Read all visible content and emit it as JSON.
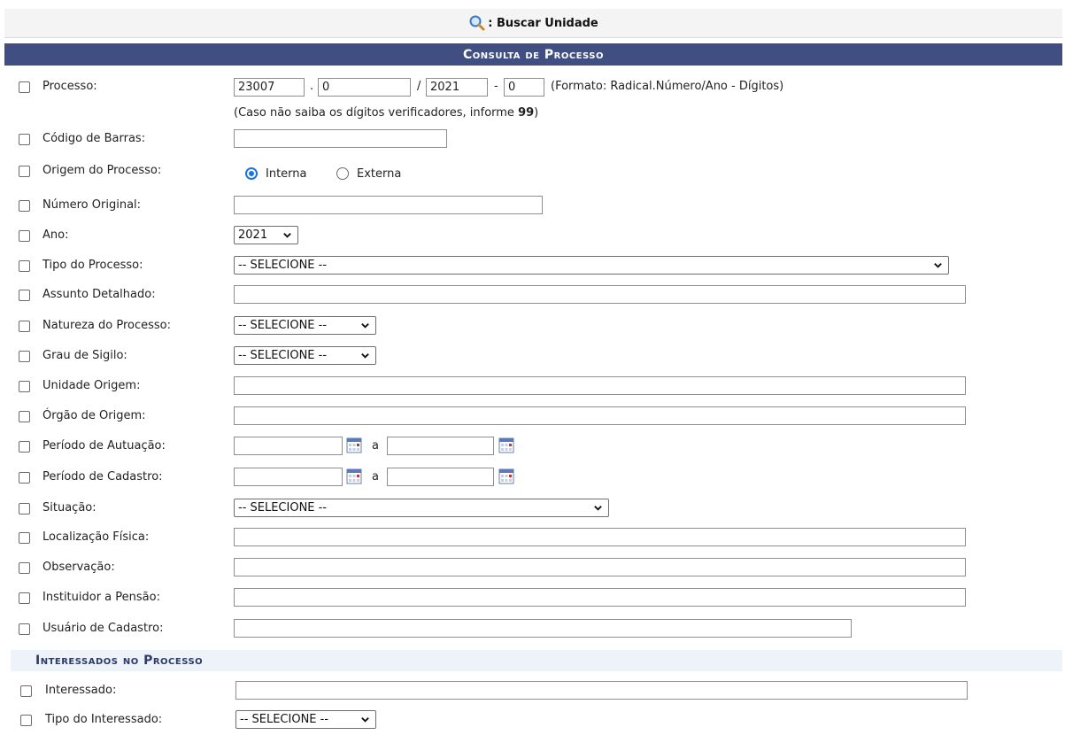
{
  "top": {
    "label": ": Buscar Unidade",
    "icon": "search-icon"
  },
  "header": {
    "title": "Consulta de Processo"
  },
  "processo": {
    "label": "Processo:",
    "radical": "23007",
    "numero": "0",
    "ano": "2021",
    "digitos": "0",
    "sep_dot": ".",
    "sep_slash": "/",
    "sep_dash": "-",
    "formato": "(Formato: Radical.Número/Ano - Dígitos)",
    "hint_prefix": "(Caso não saiba os dígitos verificadores, informe ",
    "hint_bold": "99",
    "hint_suffix": ")"
  },
  "codigo_barras": {
    "label": "Código de Barras:",
    "value": ""
  },
  "origem": {
    "label": "Origem do Processo:",
    "opt_interna": "Interna",
    "opt_externa": "Externa",
    "selected": "Interna"
  },
  "numero_original": {
    "label": "Número Original:",
    "value": ""
  },
  "ano": {
    "label": "Ano:",
    "value": "2021"
  },
  "tipo_processo": {
    "label": "Tipo do Processo:",
    "value": "-- SELECIONE --"
  },
  "assunto": {
    "label": "Assunto Detalhado:",
    "value": ""
  },
  "natureza": {
    "label": "Natureza do Processo:",
    "value": "-- SELECIONE --"
  },
  "sigilo": {
    "label": "Grau de Sigilo:",
    "value": "-- SELECIONE --"
  },
  "unidade_origem": {
    "label": "Unidade Origem:",
    "value": ""
  },
  "orgao_origem": {
    "label": "Órgão de Origem:",
    "value": ""
  },
  "periodo_autuacao": {
    "label": "Período de Autuação:",
    "sep": "a"
  },
  "periodo_cadastro": {
    "label": "Período de Cadastro:",
    "sep": "a"
  },
  "situacao": {
    "label": "Situação:",
    "value": "-- SELECIONE --"
  },
  "localizacao": {
    "label": "Localização Física:",
    "value": ""
  },
  "observacao": {
    "label": "Observação:",
    "value": ""
  },
  "instituidor": {
    "label": "Instituidor a Pensão:",
    "value": ""
  },
  "usuario": {
    "label": "Usuário de Cadastro:",
    "value": ""
  },
  "interessados": {
    "title": "Interessados no Processo"
  },
  "interessado": {
    "label": "Interessado:",
    "value": ""
  },
  "tipo_interessado": {
    "label": "Tipo do Interessado:",
    "value": "-- SELECIONE --"
  },
  "colors": {
    "header_bg": "#404e82",
    "subheader_text": "#2c3b6b",
    "radio_accent": "#1a73e8"
  }
}
